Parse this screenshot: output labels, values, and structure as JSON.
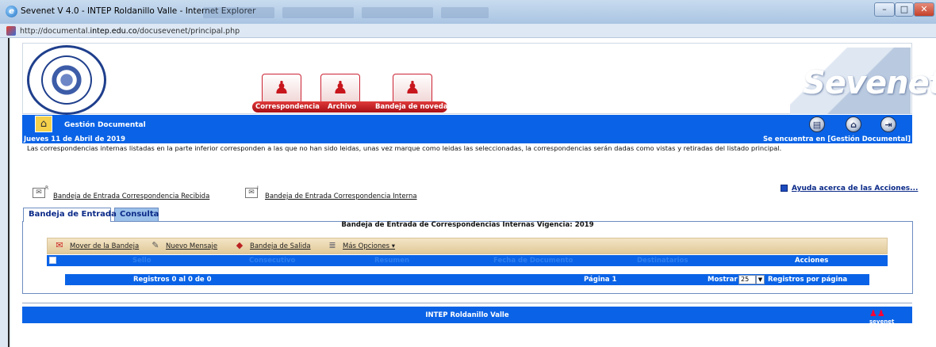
{
  "window": {
    "title": "Sevenet V 4.0 - INTEP Roldanillo Valle - Internet Explorer",
    "url_prefix": "http://documental.",
    "url_domain": "intep.edu.co",
    "url_path": "/docusevenet/principal.php"
  },
  "header": {
    "modules": [
      "Correspondencia",
      "Archivo",
      "Bandeja de novedades"
    ],
    "logo_text": "Sevenet"
  },
  "bar": {
    "title": "Gestión Documental",
    "date": "Jueves 11 de Abril de 2019",
    "location": "Se encuentra en [Gestión Documental]"
  },
  "info": "Las correspondencias internas listadas en la parte inferior corresponden a las que no han sido leidas, unas vez marque como leidas las seleccionadas, la correspondencias serán dadas como vistas y retiradas del listado principal.",
  "help_link": "Ayuda acerca de las Acciones...",
  "inboxes": {
    "received": "Bandeja de Entrada Correspondencia Recibida",
    "received_sup": "R",
    "internal": "Bandeja de Entrada Correspondencia Interna",
    "internal_sup": "I"
  },
  "tabs": [
    "Bandeja de Entrada",
    "Consulta"
  ],
  "panel": {
    "title": "Bandeja de Entrada de Correspondencias Internas Vigencia: 2019",
    "toolbar": [
      "Mover de la Bandeja",
      "Nuevo Mensaje",
      "Bandeja de Salida",
      "Más Opciones"
    ],
    "columns": [
      "Sello",
      "Consecutivo",
      "Resumen",
      "Fecha de Documento",
      "Destinatarios",
      "Acciones"
    ],
    "records": "Registros 0 al 0 de 0",
    "page": "Página 1",
    "show_label": "Mostrar",
    "page_size": "25",
    "per_page": "Registros por página"
  },
  "footer": {
    "org": "INTEP Roldanillo Valle",
    "logo": "sevenet"
  }
}
